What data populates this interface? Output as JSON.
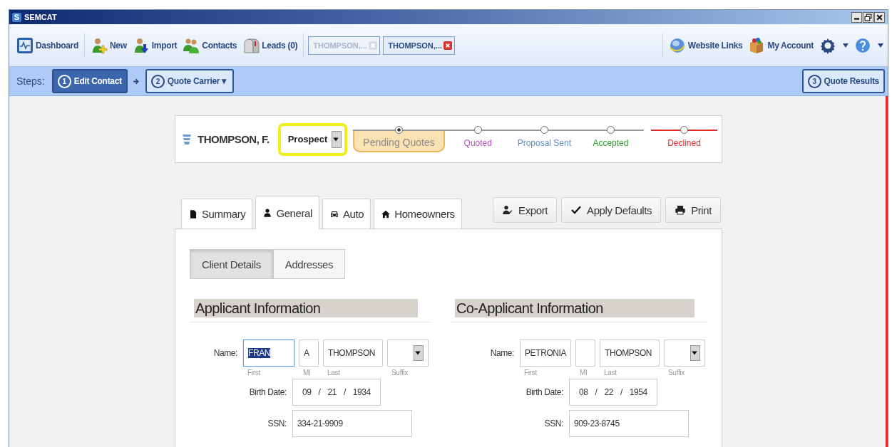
{
  "window": {
    "logo": "S",
    "title": "SEMCAT"
  },
  "toolbar": {
    "items": [
      {
        "kind": "dashboard",
        "label": "Dashboard"
      },
      {
        "kind": "new",
        "label": "New"
      },
      {
        "kind": "import",
        "label": "Import"
      },
      {
        "kind": "contacts",
        "label": "Contacts"
      },
      {
        "kind": "leads",
        "label": "Leads (0)"
      }
    ],
    "open_tabs": [
      {
        "label": "THOMPSON,...",
        "selected": false
      },
      {
        "label": "THOMPSON,...",
        "selected": true
      }
    ],
    "right_items": [
      {
        "kind": "globe",
        "label": "Website Links"
      },
      {
        "kind": "box",
        "label": "My Account"
      },
      {
        "kind": "settings"
      },
      {
        "kind": "help"
      }
    ]
  },
  "steps": {
    "label": "Steps:",
    "items": [
      {
        "number": "1",
        "label": "Edit Contact",
        "selected": true
      },
      {
        "number": "2",
        "label": "Quote Carrier▼",
        "selected": false
      }
    ],
    "results": {
      "number": "3",
      "label": "Quote Results"
    }
  },
  "contact": {
    "name": "THOMPSON, F.",
    "status": "Prospect",
    "stages": [
      {
        "label": "Pending Quotes",
        "color": "#8a8a8a",
        "kind": "step",
        "selected": true
      },
      {
        "label": "Quoted",
        "color": "#b050c0",
        "kind": "step",
        "selected": false
      },
      {
        "label": "Proposal Sent",
        "color": "#5f8ac4",
        "kind": "step",
        "selected": false
      },
      {
        "label": "Accepted",
        "color": "#2f9a2f",
        "kind": "step",
        "selected": false
      },
      {
        "label": "Declined",
        "color": "#e42828",
        "kind": "terminal",
        "selected": false
      }
    ]
  },
  "tabs": [
    {
      "kind": "document",
      "label": "Summary",
      "selected": false
    },
    {
      "kind": "person",
      "label": "General",
      "selected": true
    },
    {
      "kind": "car",
      "label": "Auto",
      "selected": false
    },
    {
      "kind": "house",
      "label": "Homeowners",
      "selected": false
    }
  ],
  "actions": [
    {
      "kind": "export",
      "label": "Export"
    },
    {
      "kind": "check",
      "label": "Apply Defaults"
    },
    {
      "kind": "print",
      "label": "Print"
    }
  ],
  "subtabs": [
    {
      "label": "Client Details",
      "selected": true
    },
    {
      "label": "Addresses",
      "selected": false
    }
  ],
  "sections": [
    {
      "title": "Applicant Information",
      "name_label": "Name:",
      "first": {
        "value": "FRAN",
        "caption": "First",
        "highlighted": true
      },
      "mi": {
        "value": "A",
        "caption": "MI"
      },
      "last": {
        "value": "THOMPSON",
        "caption": "Last"
      },
      "suffix": {
        "caption": "Suffix"
      },
      "birth_label": "Birth Date:",
      "birth": "09 / 21 / 1934",
      "ssn_label": "SSN:",
      "ssn": "334-21-9909"
    },
    {
      "title": "Co-Applicant Information",
      "name_label": "Name:",
      "first": {
        "value": "PETRONIA",
        "caption": "First",
        "highlighted": false
      },
      "mi": {
        "caption": "MI"
      },
      "last": {
        "value": "THOMPSON",
        "caption": "Last"
      },
      "suffix": {
        "caption": "Suffix"
      },
      "birth_label": "Birth Date:",
      "birth": "08 / 22 / 1954",
      "ssn_label": "SSN:",
      "ssn": "909-23-8745"
    }
  ]
}
